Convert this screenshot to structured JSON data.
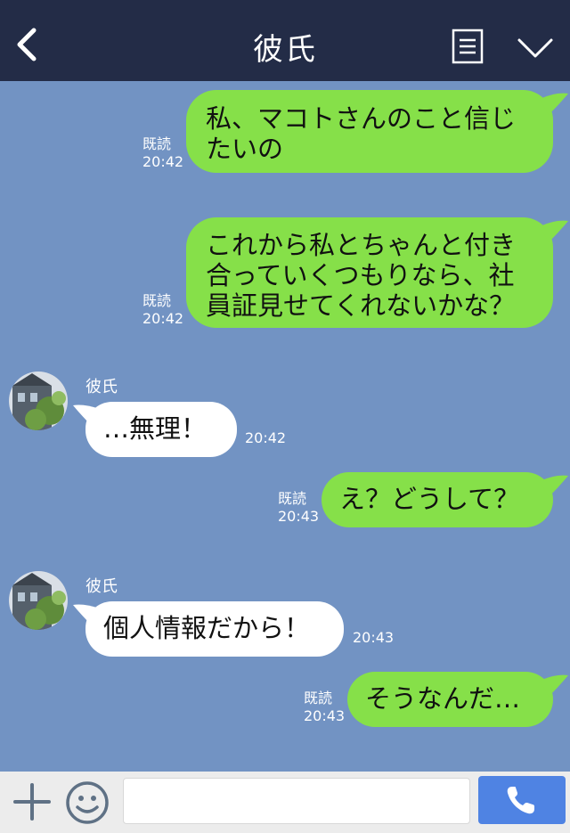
{
  "header": {
    "title": "彼氏"
  },
  "messages": [
    {
      "direction": "out",
      "read": "既読",
      "time": "20:42",
      "lines": [
        "私、マコトさんのこと信じ",
        "たいの"
      ]
    },
    {
      "direction": "out",
      "read": "既読",
      "time": "20:42",
      "lines": [
        "これから私とちゃんと付き",
        "合っていくつもりなら、社",
        "員証見せてくれないかな？"
      ]
    },
    {
      "direction": "in",
      "sender": "彼氏",
      "time": "20:42",
      "lines": [
        "…無理！"
      ]
    },
    {
      "direction": "out",
      "read": "既読",
      "time": "20:43",
      "lines": [
        "え？どうして？"
      ]
    },
    {
      "direction": "in",
      "sender": "彼氏",
      "time": "20:43",
      "lines": [
        "個人情報だから！"
      ]
    },
    {
      "direction": "out",
      "read": "既読",
      "time": "20:43",
      "lines": [
        "そうなんだ…"
      ]
    }
  ],
  "footer": {
    "input_placeholder": ""
  },
  "colors": {
    "header_bg": "#232c47",
    "chat_bg": "#7293c3",
    "outgoing_bubble": "#86e049",
    "incoming_bubble": "#ffffff",
    "call_button": "#4f83e3"
  },
  "icons": [
    "back-arrow-icon",
    "menu-list-icon",
    "chevron-down-icon",
    "plus-icon",
    "emoji-icon",
    "phone-icon"
  ]
}
